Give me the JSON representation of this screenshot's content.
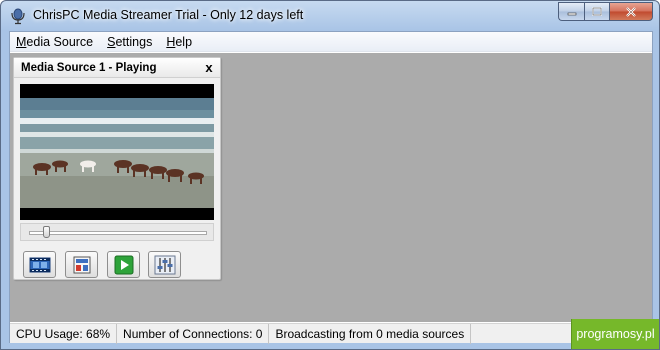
{
  "window": {
    "title": "ChrisPC Media Streamer Trial - Only 12 days left"
  },
  "menu": {
    "items": [
      {
        "label": "Media Source",
        "mnemonic": "M"
      },
      {
        "label": "Settings",
        "mnemonic": "S"
      },
      {
        "label": "Help",
        "mnemonic": "H"
      }
    ]
  },
  "media_panel": {
    "title": "Media Source 1 - Playing",
    "close_label": "x",
    "seek_fraction": 0.08,
    "buttons": [
      {
        "name": "filmstrip-icon"
      },
      {
        "name": "source-settings-icon"
      },
      {
        "name": "play-icon"
      },
      {
        "name": "equalizer-icon"
      }
    ]
  },
  "status": {
    "cpu": "CPU Usage: 68%",
    "connections": "Number of Connections: 0",
    "broadcasting": "Broadcasting from 0 media sources"
  },
  "watermark": "programosy.pl",
  "colors": {
    "play_green": "#2ea33a",
    "watermark_green": "#76b82a"
  }
}
